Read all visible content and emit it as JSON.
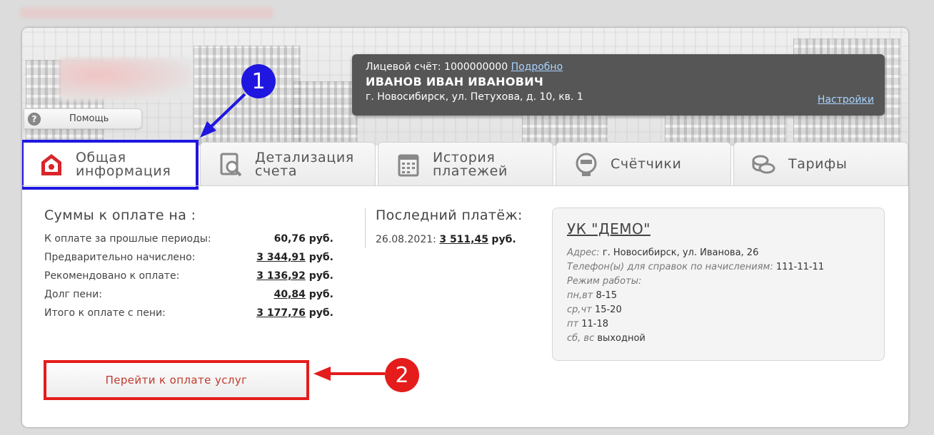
{
  "help": {
    "label": "Помощь",
    "icon": "question-icon"
  },
  "account": {
    "label": "Лицевой счёт:",
    "number": "1000000000",
    "details_link": "Подробно",
    "name": "ИВАНОВ ИВАН ИВАНОВИЧ",
    "address": "г. Новосибирск, ул. Петухова, д. 10, кв. 1",
    "settings_link": "Настройки"
  },
  "tabs": [
    {
      "line1": "Общая",
      "line2": "информация",
      "icon": "home-icon"
    },
    {
      "line1": "Детализация",
      "line2": "счета",
      "icon": "document-search-icon"
    },
    {
      "line1": "История",
      "line2": "платежей",
      "icon": "calendar-icon"
    },
    {
      "line1": "Счётчики",
      "line2": "",
      "icon": "meter-icon"
    },
    {
      "line1": "Тарифы",
      "line2": "",
      "icon": "coins-icon"
    }
  ],
  "sums": {
    "title": "Суммы к оплате на :",
    "currency": "руб.",
    "rows": [
      {
        "label": "К оплате за прошлые периоды:",
        "value": "60,76"
      },
      {
        "label": "Предварительно начислено:",
        "value": "3 344,91"
      },
      {
        "label": "Рекомендовано к оплате:",
        "value": "3 136,92"
      },
      {
        "label": "Долг пени:",
        "value": "40,84"
      },
      {
        "label": "Итого к оплате с пени:",
        "value": "3 177,76"
      }
    ]
  },
  "last_payment": {
    "title": "Последний платёж:",
    "date": "26.08.2021:",
    "amount": "3 511,45",
    "currency": "руб."
  },
  "company": {
    "name": "УК \"ДЕМО\"",
    "address_label": "Адрес:",
    "address": "г. Новосибирск, ул. Иванова, 26",
    "phone_label": "Телефон(ы) для справок по начислениям:",
    "phone": "111-11-11",
    "hours_label": "Режим работы:",
    "hours": [
      {
        "days": "пн,вт",
        "time": "8-15"
      },
      {
        "days": "ср,чт",
        "time": "15-20"
      },
      {
        "days": "пт",
        "time": "11-18"
      },
      {
        "days": "сб, вс",
        "time": "выходной"
      }
    ]
  },
  "pay_button": "Перейти к оплате услуг",
  "annotations": {
    "badge1": "1",
    "badge2": "2",
    "color1": "#1f17e0",
    "color2": "#e51c1c"
  }
}
